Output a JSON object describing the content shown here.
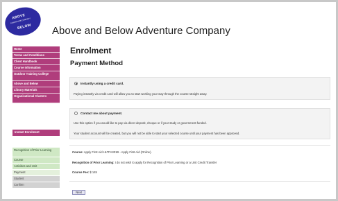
{
  "logo": {
    "top": "ABOVE",
    "middle": "ADVENTURE COMPANY",
    "bottom": "BELOW"
  },
  "site_title": "Above and Below Adventure Company",
  "sidebar": {
    "items": [
      {
        "label": "Home"
      },
      {
        "label": "Terms and Conditions"
      },
      {
        "label": "Client Handbook"
      },
      {
        "label": "Course Information"
      },
      {
        "label": "Outdoor Training College"
      },
      {
        "label": "Above and Below"
      },
      {
        "label": "Library Materials"
      },
      {
        "label": "Organisational Clusters"
      }
    ],
    "instant_button": "Instant Enrolment"
  },
  "steps": [
    {
      "label": "Recognition of Prior Learning"
    },
    {
      "label": "Course"
    },
    {
      "label": "Activities and Unit"
    },
    {
      "label": "Payment"
    },
    {
      "label": "Student"
    },
    {
      "label": "Confirm"
    }
  ],
  "page_title": "Enrolment",
  "section_title": "Payment Method",
  "option_card": {
    "label": "Instantly using a credit card.",
    "description": "Paying instantly via credit card will allow you to start working your way through the course straight away.",
    "selected": true
  },
  "option_contact": {
    "label": "Contact me about payment.",
    "description": "Use this option if you would like to pay via direct deposit, cheque or if your study or government-funded.",
    "note": "Your student account will be created, but you will not be able to start your selected course until your payment has been approved.",
    "selected": false
  },
  "summary": {
    "course_label": "Course:",
    "course_value": "Apply First Aid HLTFA301B - Apply First Aid (Online).",
    "rpl_label": "Recognition of Prior Learning:",
    "rpl_value": "I do not wish to apply for Recognition of Prior Learning or a Unit Credit Transfer",
    "fee_label": "Course Fee:",
    "fee_value": "$ 145"
  },
  "next_button": "Next",
  "colors": {
    "menu": "#b03d7c",
    "steps": "#cfe8c4",
    "logo": "#2d2aa0"
  }
}
